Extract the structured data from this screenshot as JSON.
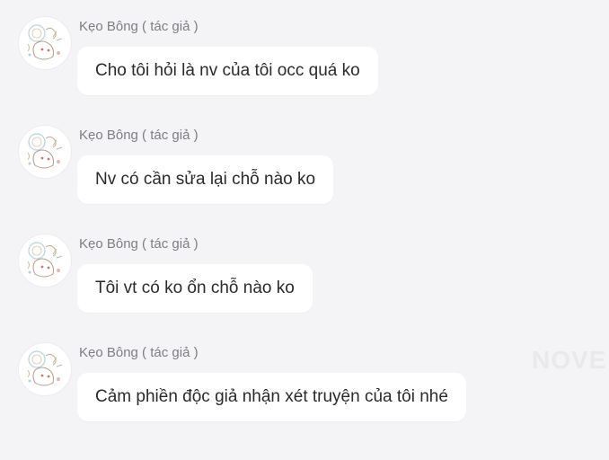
{
  "messages": [
    {
      "author": "Kẹo Bông ( tác giả )",
      "text": "Cho tôi hỏi là nv của tôi occ quá ko",
      "avatar_icon": "sketch-avatar-icon"
    },
    {
      "author": "Kẹo Bông ( tác giả )",
      "text": "Nv có cần sửa lại chỗ nào ko",
      "avatar_icon": "sketch-avatar-icon"
    },
    {
      "author": "Kẹo Bông ( tác giả )",
      "text": "Tôi vt có ko ổn chỗ nào ko",
      "avatar_icon": "sketch-avatar-icon"
    },
    {
      "author": "Kẹo Bông ( tác giả )",
      "text": "Cảm phiền độc giả nhận xét truyện của tôi nhé",
      "avatar_icon": "sketch-avatar-icon"
    }
  ],
  "watermark": "NOVE",
  "colors": {
    "background": "#f4f4f6",
    "bubble": "#ffffff",
    "author_text": "#7d7d84",
    "message_text": "#2b2b2e"
  }
}
